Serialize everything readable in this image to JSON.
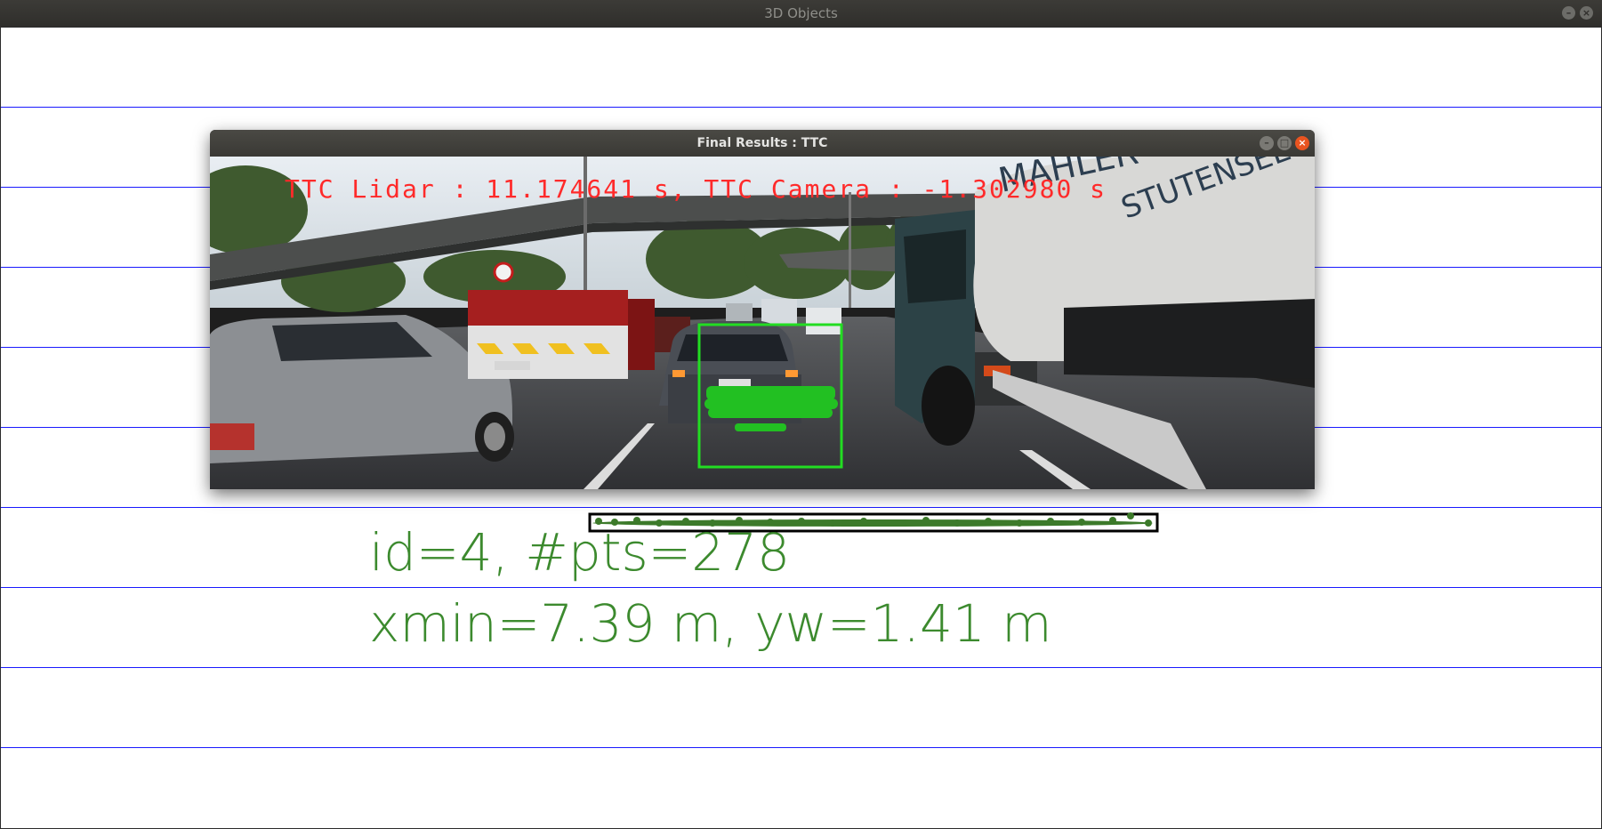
{
  "outer_window": {
    "title": "3D Objects"
  },
  "inner_window": {
    "title": "Final Results : TTC"
  },
  "overlay": {
    "ttc_text": "TTC Lidar : 11.174641 s, TTC Camera : -1.302980 s"
  },
  "object": {
    "line1": "id=4, #pts=278",
    "line2": "xmin=7.39 m, yw=1.41 m"
  },
  "colors": {
    "ttc_text": "#ff2a2a",
    "bbox": "#22dd22",
    "lidar_points": "#22c022",
    "gridlines": "#1a1aff",
    "object_text": "#3c8a2e"
  }
}
